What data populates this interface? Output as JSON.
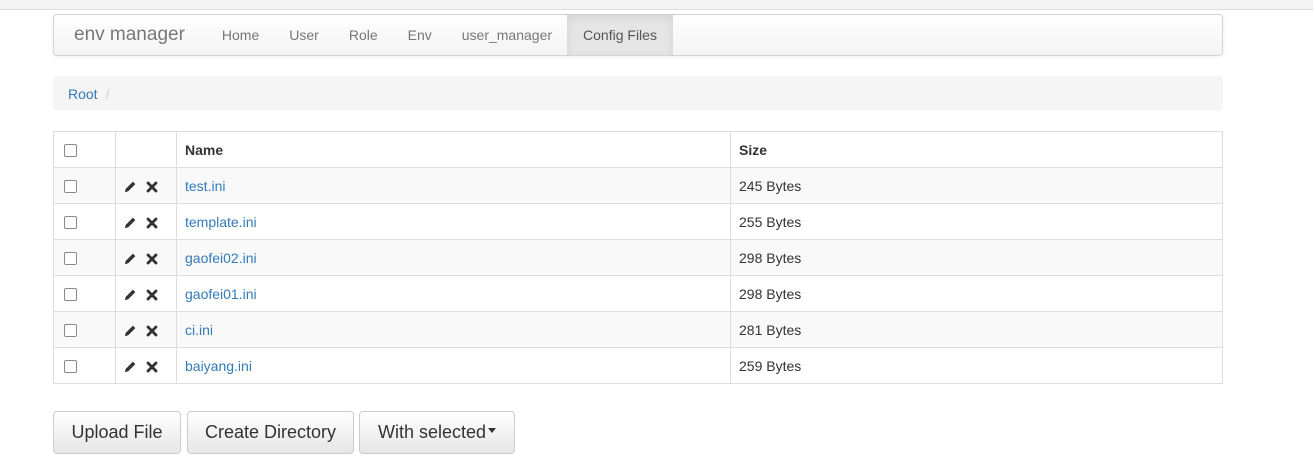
{
  "navbar": {
    "brand": "env manager",
    "items": [
      {
        "label": "Home"
      },
      {
        "label": "User"
      },
      {
        "label": "Role"
      },
      {
        "label": "Env"
      },
      {
        "label": "user_manager"
      },
      {
        "label": "Config Files",
        "active": true
      }
    ]
  },
  "breadcrumb": {
    "root": "Root",
    "separator": "/"
  },
  "table": {
    "headers": {
      "name": "Name",
      "size": "Size"
    },
    "rows": [
      {
        "name": "test.ini",
        "size": "245 Bytes"
      },
      {
        "name": "template.ini",
        "size": "255 Bytes"
      },
      {
        "name": "gaofei02.ini",
        "size": "298 Bytes"
      },
      {
        "name": "gaofei01.ini",
        "size": "298 Bytes"
      },
      {
        "name": "ci.ini",
        "size": "281 Bytes"
      },
      {
        "name": "baiyang.ini",
        "size": "259 Bytes"
      }
    ],
    "row_icons": [
      "pencil-icon",
      "times-icon"
    ]
  },
  "buttons": {
    "upload": "Upload File",
    "create_dir": "Create Directory",
    "with_selected": "With selected"
  },
  "colors": {
    "link": "#337ab7",
    "nav_text": "#777777",
    "active_nav_bg": "#e5e5e5"
  }
}
